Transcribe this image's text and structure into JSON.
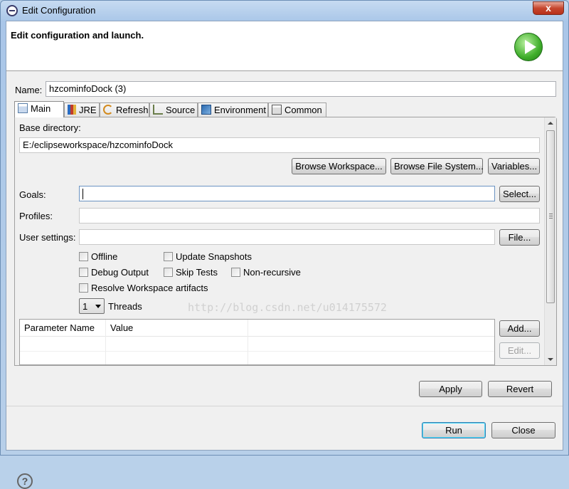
{
  "window": {
    "title": "Edit Configuration",
    "close_glyph": "x"
  },
  "header": {
    "title": "Edit configuration and launch.",
    "icon": "run-launch-icon"
  },
  "name_row": {
    "label": "Name:",
    "value": "hzcominfoDock (3)"
  },
  "tabs": [
    {
      "label": "Main",
      "icon": "main-tab-icon",
      "active": true
    },
    {
      "label": "JRE",
      "icon": "jre-icon"
    },
    {
      "label": "Refresh",
      "icon": "refresh-icon"
    },
    {
      "label": "Source",
      "icon": "source-icon"
    },
    {
      "label": "Environment",
      "icon": "environment-icon"
    },
    {
      "label": "Common",
      "icon": "common-icon"
    }
  ],
  "main": {
    "base_directory_label": "Base directory:",
    "base_directory_value": "E:/eclipseworkspace/hzcominfoDock",
    "browse_workspace": "Browse Workspace...",
    "browse_file_system": "Browse File System...",
    "variables": "Variables...",
    "goals_label": "Goals:",
    "goals_value": "",
    "select_button": "Select...",
    "profiles_label": "Profiles:",
    "profiles_value": "",
    "user_settings_label": "User settings:",
    "user_settings_value": "",
    "file_button": "File...",
    "checkboxes": {
      "offline": "Offline",
      "update_snapshots": "Update Snapshots",
      "debug_output": "Debug Output",
      "skip_tests": "Skip Tests",
      "non_recursive": "Non-recursive",
      "resolve_workspace": "Resolve Workspace artifacts"
    },
    "threads_value": "1",
    "threads_label": "Threads",
    "table": {
      "columns": [
        "Parameter Name",
        "Value"
      ]
    },
    "add_button": "Add...",
    "edit_button": "Edit..."
  },
  "watermark": "http://blog.csdn.net/u014175572",
  "footer": {
    "apply": "Apply",
    "revert": "Revert",
    "help_glyph": "?",
    "run": "Run",
    "close": "Close"
  }
}
